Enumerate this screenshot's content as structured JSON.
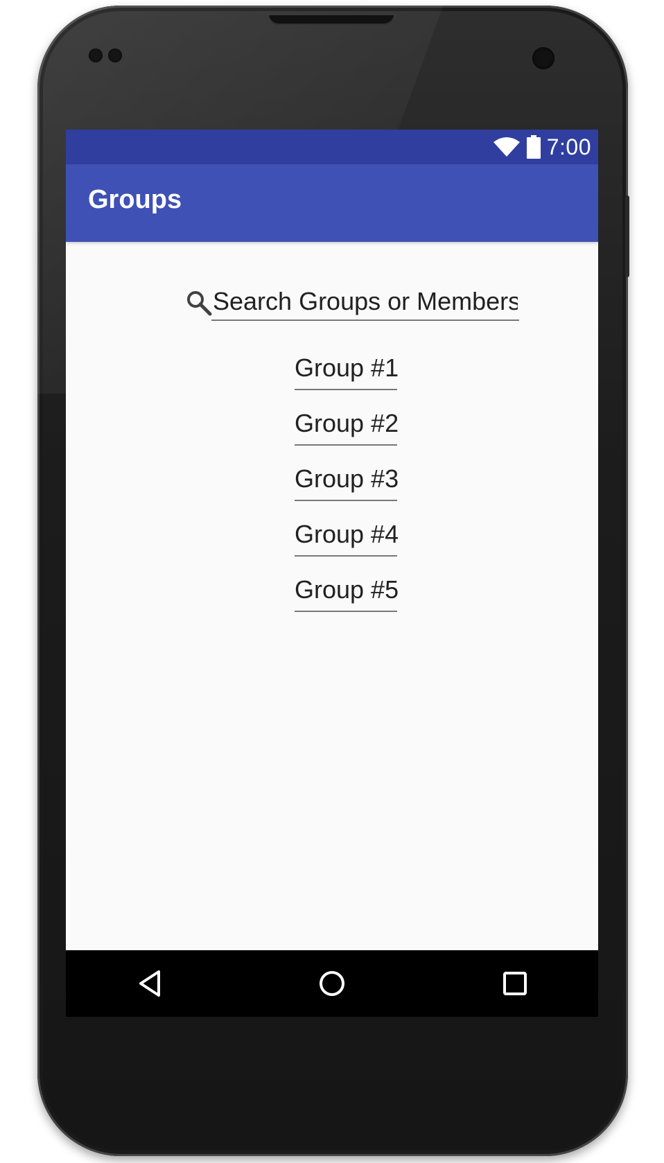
{
  "status_bar": {
    "time": "7:00",
    "icons": [
      "wifi-icon",
      "battery-icon"
    ],
    "color": "#303f9f"
  },
  "app_bar": {
    "title": "Groups",
    "color": "#3f51b5"
  },
  "search": {
    "placeholder": "Search Groups or Members",
    "icon": "search-icon"
  },
  "groups": [
    "Group #1",
    "Group #2",
    "Group #3",
    "Group #4",
    "Group #5"
  ],
  "nav_bar": {
    "buttons": [
      "back-icon",
      "home-icon",
      "recents-icon"
    ]
  },
  "colors": {
    "screen_background": "#fafafa",
    "text": "#212121",
    "underline": "#777777"
  }
}
